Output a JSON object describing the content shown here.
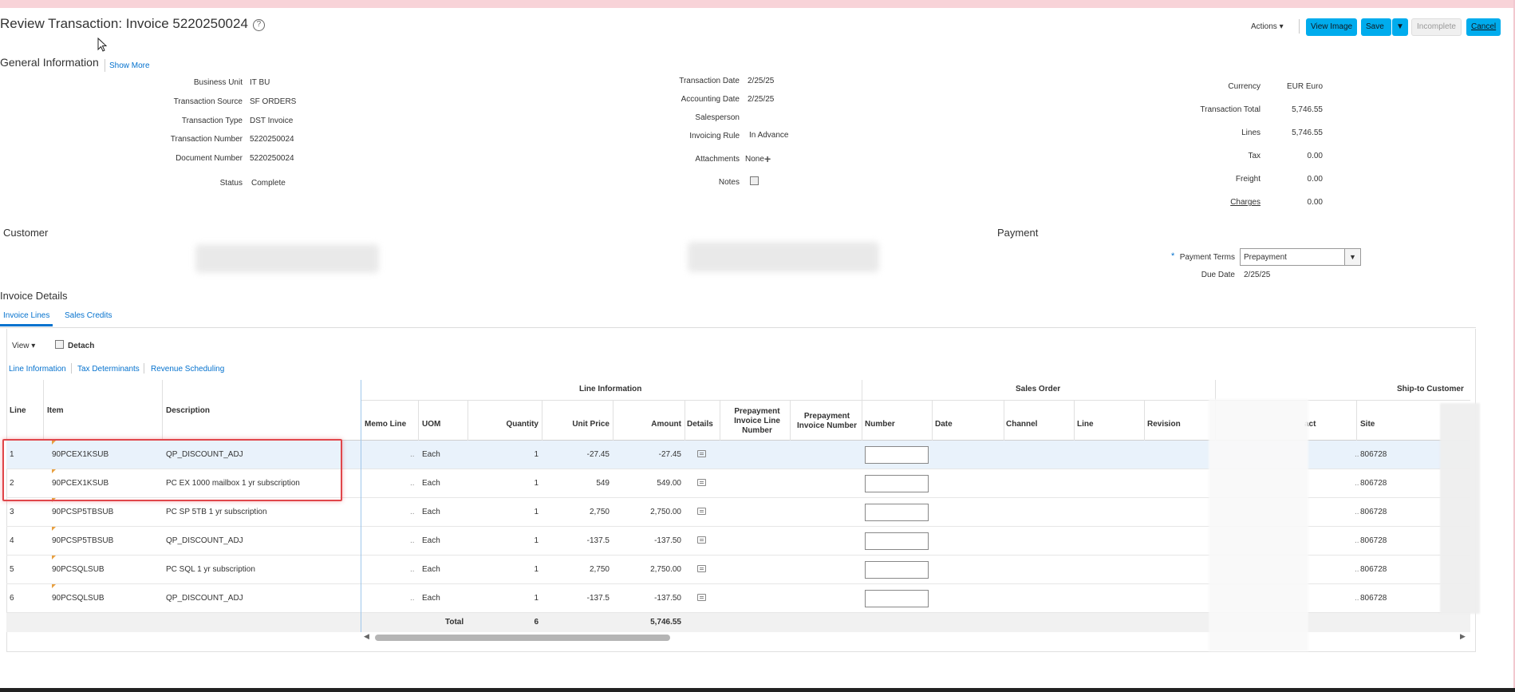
{
  "page": {
    "title": "Review Transaction: Invoice 5220250024",
    "help_icon": "?"
  },
  "toolbar": {
    "actions_label": "Actions",
    "view_image_label": "View Image",
    "save_label": "Save",
    "incomplete_label": "Incomplete",
    "cancel_label": "Cancel",
    "accent_color": "#00aced"
  },
  "general": {
    "heading": "General Information",
    "show_more": "Show More",
    "col1": [
      {
        "label": "Business Unit",
        "value": "IT BU"
      },
      {
        "label": "Transaction Source",
        "value": "SF ORDERS"
      },
      {
        "label": "Transaction Type",
        "value": "DST Invoice"
      },
      {
        "label": "Transaction Number",
        "value": "5220250024"
      },
      {
        "label": "Document Number",
        "value": "5220250024"
      }
    ],
    "status_label": "Status",
    "status_value": "Complete",
    "col2": [
      {
        "label": "Transaction Date",
        "value": "2/25/25"
      },
      {
        "label": "Accounting Date",
        "value": "2/25/25"
      },
      {
        "label": "Salesperson",
        "value": ""
      },
      {
        "label": "Invoicing Rule",
        "value": "In Advance"
      }
    ],
    "attachments_label": "Attachments",
    "attachments_value": "None",
    "notes_label": "Notes",
    "col3": [
      {
        "label": "Currency",
        "value": "EUR Euro"
      },
      {
        "label": "Transaction Total",
        "value": "5,746.55"
      },
      {
        "label": "Lines",
        "value": "5,746.55"
      },
      {
        "label": "Tax",
        "value": "0.00"
      },
      {
        "label": "Freight",
        "value": "0.00"
      },
      {
        "label": "Charges",
        "value": "0.00"
      }
    ]
  },
  "customer": {
    "heading": "Customer"
  },
  "payment": {
    "heading": "Payment",
    "terms_required": "*",
    "terms_label": "Payment Terms",
    "terms_value": "Prepayment",
    "due_label": "Due Date",
    "due_value": "2/25/25"
  },
  "invoice_details": {
    "heading": "Invoice Details",
    "tabs": [
      "Invoice Lines",
      "Sales Credits"
    ],
    "view_label": "View",
    "detach_label": "Detach",
    "subtabs": [
      "Line Information",
      "Tax Determinants",
      "Revenue Scheduling"
    ]
  },
  "table": {
    "group_headers": {
      "line_information": "Line Information",
      "sales_order": "Sales Order",
      "ship_to": "Ship-to Customer"
    },
    "columns": {
      "line": "Line",
      "item": "Item",
      "description": "Description",
      "memo_line": "Memo Line",
      "uom": "UOM",
      "quantity": "Quantity",
      "unit_price": "Unit Price",
      "amount": "Amount",
      "details": "Details",
      "prepay_line": "Prepayment Invoice Line Number",
      "prepay_number": "Prepayment Invoice Number",
      "so_number": "Number",
      "so_date": "Date",
      "so_channel": "Channel",
      "so_line": "Line",
      "so_revision": "Revision",
      "contact_partial": "act",
      "site": "Site"
    },
    "rows": [
      {
        "line": "1",
        "item": "90PCEX1KSUB",
        "description": "QP_DISCOUNT_ADJ",
        "memo": "..",
        "uom": "Each",
        "qty": "1",
        "unit_price": "-27.45",
        "amount": "-27.45",
        "site": "806728"
      },
      {
        "line": "2",
        "item": "90PCEX1KSUB",
        "description": "PC EX 1000 mailbox 1 yr subscription",
        "memo": "..",
        "uom": "Each",
        "qty": "1",
        "unit_price": "549",
        "amount": "549.00",
        "site": "806728"
      },
      {
        "line": "3",
        "item": "90PCSP5TBSUB",
        "description": "PC SP 5TB 1 yr subscription",
        "memo": "..",
        "uom": "Each",
        "qty": "1",
        "unit_price": "2,750",
        "amount": "2,750.00",
        "site": "806728"
      },
      {
        "line": "4",
        "item": "90PCSP5TBSUB",
        "description": "QP_DISCOUNT_ADJ",
        "memo": "..",
        "uom": "Each",
        "qty": "1",
        "unit_price": "-137.5",
        "amount": "-137.50",
        "site": "806728"
      },
      {
        "line": "5",
        "item": "90PCSQLSUB",
        "description": "PC SQL 1 yr subscription",
        "memo": "..",
        "uom": "Each",
        "qty": "1",
        "unit_price": "2,750",
        "amount": "2,750.00",
        "site": "806728"
      },
      {
        "line": "6",
        "item": "90PCSQLSUB",
        "description": "QP_DISCOUNT_ADJ",
        "memo": "..",
        "uom": "Each",
        "qty": "1",
        "unit_price": "-137.5",
        "amount": "-137.50",
        "site": "806728"
      }
    ],
    "total_label": "Total",
    "total_qty": "6",
    "total_amount": "5,746.55"
  }
}
